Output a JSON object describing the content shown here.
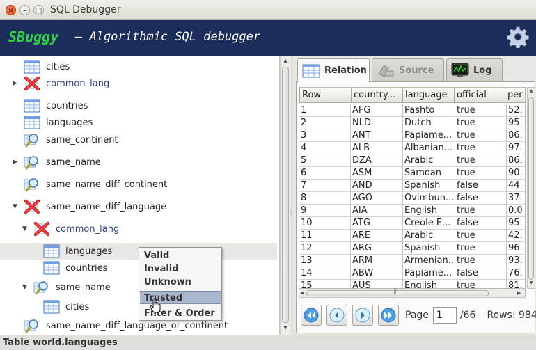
{
  "window": {
    "title": "SQL Debugger"
  },
  "header": {
    "brand": "SBuggy",
    "tagline": "–  Algorithmic SQL debugger"
  },
  "tree": {
    "items": [
      {
        "label": "cities",
        "icon": "table-icon",
        "expander": "",
        "level": 0,
        "blue": false
      },
      {
        "label": "common_lang",
        "icon": "invalid-x-icon",
        "expander": "▶",
        "level": 0,
        "blue": true
      },
      {
        "label": "countries",
        "icon": "table-icon",
        "expander": "",
        "level": 0,
        "blue": false
      },
      {
        "label": "languages",
        "icon": "table-icon",
        "expander": "",
        "level": 0,
        "blue": false
      },
      {
        "label": "same_continent",
        "icon": "view-magnifier-icon",
        "expander": "",
        "level": 0,
        "blue": false
      },
      {
        "label": "same_name",
        "icon": "view-magnifier-icon",
        "expander": "▶",
        "level": 0,
        "blue": false
      },
      {
        "label": "same_name_diff_continent",
        "icon": "view-magnifier-icon",
        "expander": "",
        "level": 0,
        "blue": false
      },
      {
        "label": "same_name_diff_language",
        "icon": "invalid-x-icon",
        "expander": "▼",
        "level": 0,
        "blue": false
      },
      {
        "label": "common_lang",
        "icon": "invalid-x-icon",
        "expander": "▼",
        "level": 1,
        "blue": true
      },
      {
        "label": "languages",
        "icon": "table-icon",
        "expander": "",
        "level": 2,
        "blue": false,
        "selected": true
      },
      {
        "label": "countries",
        "icon": "table-icon",
        "expander": "",
        "level": 2,
        "blue": false
      },
      {
        "label": "same_name",
        "icon": "view-magnifier-icon",
        "expander": "▼",
        "level": 1,
        "blue": false
      },
      {
        "label": "cities",
        "icon": "table-icon",
        "expander": "",
        "level": 2,
        "blue": false
      },
      {
        "label": "same_name_diff_language_or_continent",
        "icon": "view-magnifier-icon",
        "expander": "",
        "level": 0,
        "blue": false
      }
    ]
  },
  "context_menu": {
    "items": [
      "Valid",
      "Invalid",
      "Unknown",
      "Trusted",
      "Filter & Order"
    ],
    "highlighted": "Trusted"
  },
  "tabs": [
    {
      "label": "Relation",
      "icon": "table-icon",
      "active": true
    },
    {
      "label": "Source",
      "icon": "source-icon",
      "active": false
    },
    {
      "label": "Log",
      "icon": "log-monitor-icon",
      "active": false
    }
  ],
  "grid": {
    "columns": [
      "Row",
      "country...",
      "language",
      "official",
      "per"
    ],
    "rows": [
      [
        "1",
        "AFG",
        "Pashto",
        "true",
        "52."
      ],
      [
        "2",
        "NLD",
        "Dutch",
        "true",
        "95."
      ],
      [
        "3",
        "ANT",
        "Papiame...",
        "true",
        "86."
      ],
      [
        "4",
        "ALB",
        "Albanian...",
        "true",
        "97."
      ],
      [
        "5",
        "DZA",
        "Arabic",
        "true",
        "86."
      ],
      [
        "6",
        "ASM",
        "Samoan",
        "true",
        "90."
      ],
      [
        "7",
        "AND",
        "Spanish",
        "false",
        "44"
      ],
      [
        "8",
        "AGO",
        "Ovimbun...",
        "false",
        "37."
      ],
      [
        "9",
        "AIA",
        "English",
        "true",
        "0.0"
      ],
      [
        "10",
        "ATG",
        "Creole E...",
        "false",
        "95."
      ],
      [
        "11",
        "ARE",
        "Arabic",
        "true",
        "42."
      ],
      [
        "12",
        "ARG",
        "Spanish",
        "true",
        "96."
      ],
      [
        "13",
        "ARM",
        "Armenian...",
        "true",
        "93."
      ],
      [
        "14",
        "ABW",
        "Papiame...",
        "false",
        "76."
      ],
      [
        "15",
        "AUS",
        "English",
        "true",
        "81."
      ]
    ]
  },
  "pager": {
    "page_label": "Page",
    "page_value": "1",
    "page_total": "/66",
    "rows_label": "Rows: 984"
  },
  "status": {
    "text": "Table world.languages"
  }
}
